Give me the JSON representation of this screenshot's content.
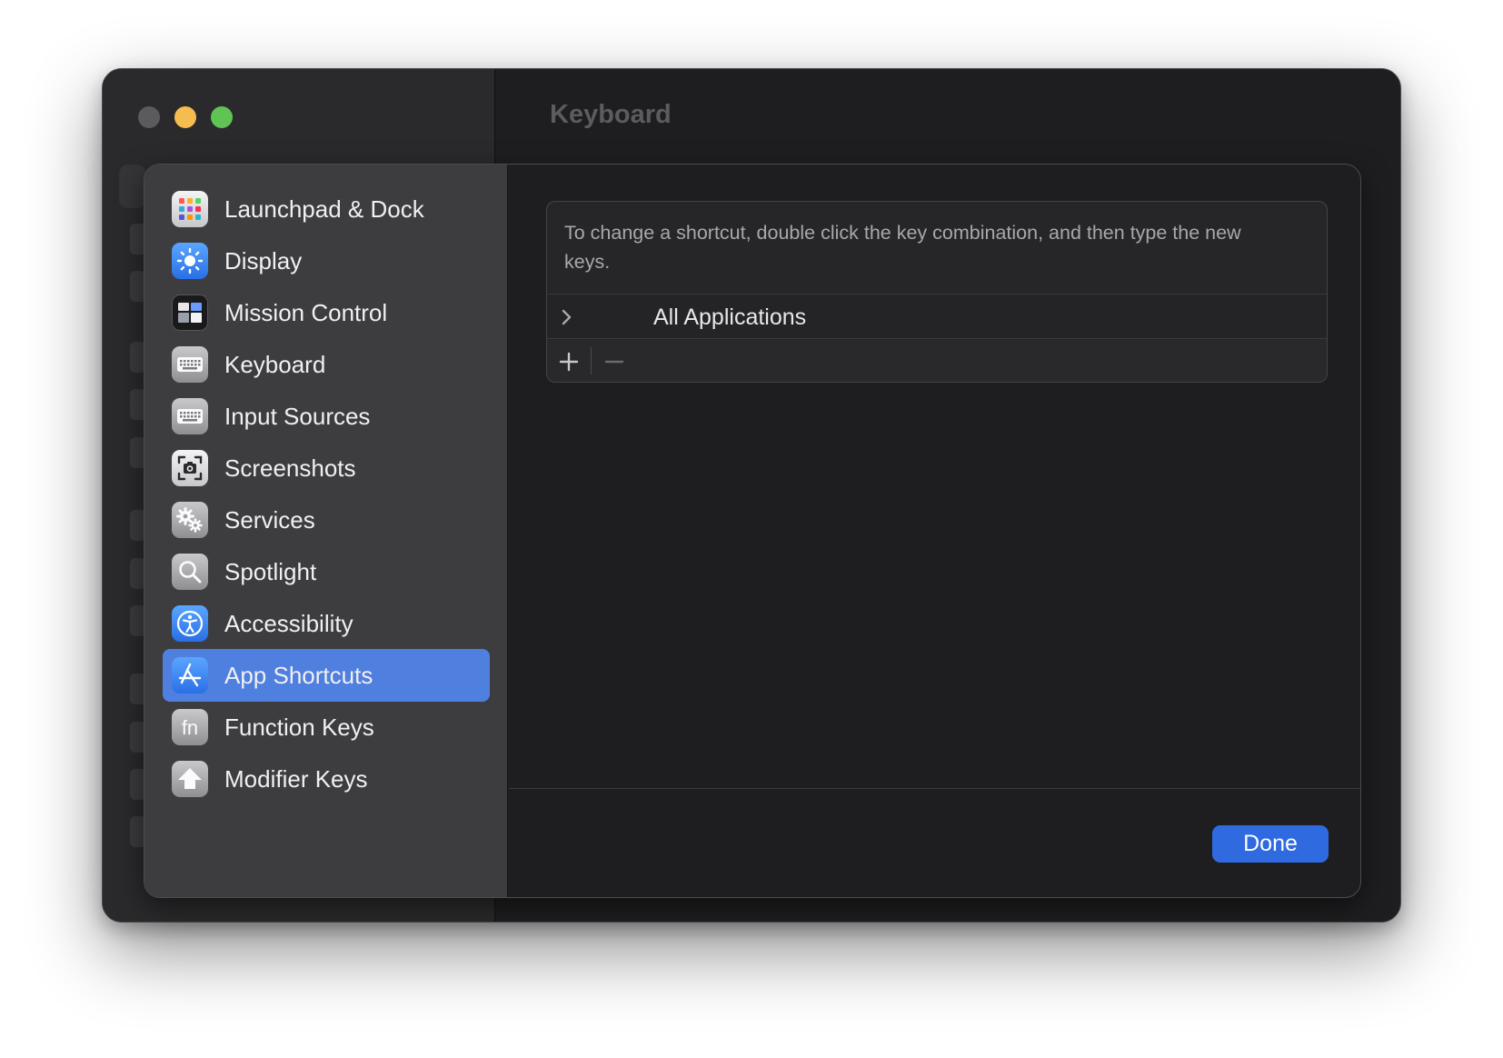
{
  "window": {
    "title": "Keyboard"
  },
  "sidebar": {
    "items": [
      {
        "label": "Launchpad & Dock",
        "icon": "launchpad-icon",
        "selected": false
      },
      {
        "label": "Display",
        "icon": "display-sun-icon",
        "selected": false
      },
      {
        "label": "Mission Control",
        "icon": "mission-control-icon",
        "selected": false
      },
      {
        "label": "Keyboard",
        "icon": "keyboard-icon",
        "selected": false
      },
      {
        "label": "Input Sources",
        "icon": "input-sources-keyboard-icon",
        "selected": false
      },
      {
        "label": "Screenshots",
        "icon": "screenshot-camera-icon",
        "selected": false
      },
      {
        "label": "Services",
        "icon": "gears-icon",
        "selected": false
      },
      {
        "label": "Spotlight",
        "icon": "magnifier-icon",
        "selected": false
      },
      {
        "label": "Accessibility",
        "icon": "accessibility-icon",
        "selected": false
      },
      {
        "label": "App Shortcuts",
        "icon": "app-store-icon",
        "selected": true
      },
      {
        "label": "Function Keys",
        "icon": "fn-key-icon",
        "selected": false
      },
      {
        "label": "Modifier Keys",
        "icon": "shift-arrow-icon",
        "selected": false
      }
    ]
  },
  "main": {
    "hint": "To change a shortcut, double click the key combination, and then type the new keys.",
    "row_label": "All Applications",
    "add_icon": "plus-icon",
    "remove_icon": "minus-icon"
  },
  "footer": {
    "done_label": "Done"
  },
  "colors": {
    "accent": "#2f6ae0",
    "selection": "#4f7fdf",
    "close": "#5b5b5e",
    "minimize": "#f5bd4f",
    "maximize": "#5fc453"
  }
}
